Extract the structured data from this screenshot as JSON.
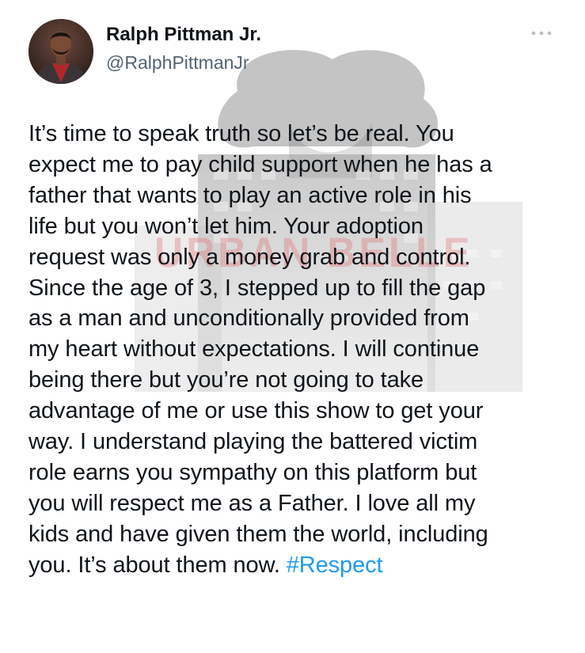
{
  "author": {
    "display_name": "Ralph Pittman Jr.",
    "handle": "@RalphPittmanJr",
    "avatar_icon": "profile-photo"
  },
  "more_icon": "more-horizontal-icon",
  "watermark": {
    "text": "URBAN BELLE"
  },
  "tweet": {
    "lines": [
      "It’s time to speak truth so let’s be real. You",
      "expect me to pay child support when he has a",
      "father that wants to play an active role in his",
      "life but you won’t let him. Your adoption",
      "request was only a money grab and control.",
      "Since the age of 3, I stepped up to fill the gap",
      "as a man and unconditionally provided from",
      "my heart without expectations. I will continue",
      "being there but you’re not going to take",
      "advantage of me or use this show to get your",
      "way. I understand playing the battered victim",
      "role earns you sympathy on this platform but",
      "you will respect me as a Father. I love all my",
      "kids and have given them the world, including"
    ],
    "last_line_text": "you. It’s about them now. ",
    "hashtag": "#Respect"
  },
  "colors": {
    "text": "#0f1419",
    "secondary": "#536471",
    "link": "#1d9bf0"
  }
}
